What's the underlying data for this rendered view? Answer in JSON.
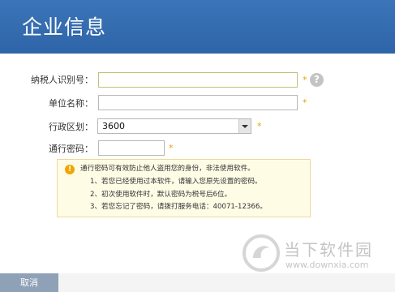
{
  "header": {
    "title": "企业信息"
  },
  "form": {
    "tax_id": {
      "label": "纳税人识别号：",
      "value": "",
      "required": "*"
    },
    "company_name": {
      "label": "单位名称：",
      "value": "",
      "required": "*"
    },
    "region": {
      "label": "行政区划：",
      "selected": "3600",
      "required": "*"
    },
    "passcode": {
      "label": "通行密码：",
      "value": "",
      "required": "*"
    },
    "help_symbol": "?"
  },
  "notice": {
    "icon_symbol": "!",
    "lines": [
      "通行密码可有效防止他人盗用您的身份，非法使用软件。",
      "1、若您已经使用过本软件，请输入您原先设置的密码。",
      "2、初次使用软件时，默认密码为税号后6位。",
      "3、若您忘记了密码，请拨打服务电话：40071-12366。"
    ]
  },
  "footer": {
    "cancel_label": "取消"
  },
  "watermark": {
    "title": "当下软件园",
    "url": "www.downxia.com"
  },
  "colors": {
    "header_bg": "#3b74b8",
    "required_star": "#e8a100",
    "notice_bg": "#fffce6",
    "cancel_bg": "#8fa1b7"
  }
}
